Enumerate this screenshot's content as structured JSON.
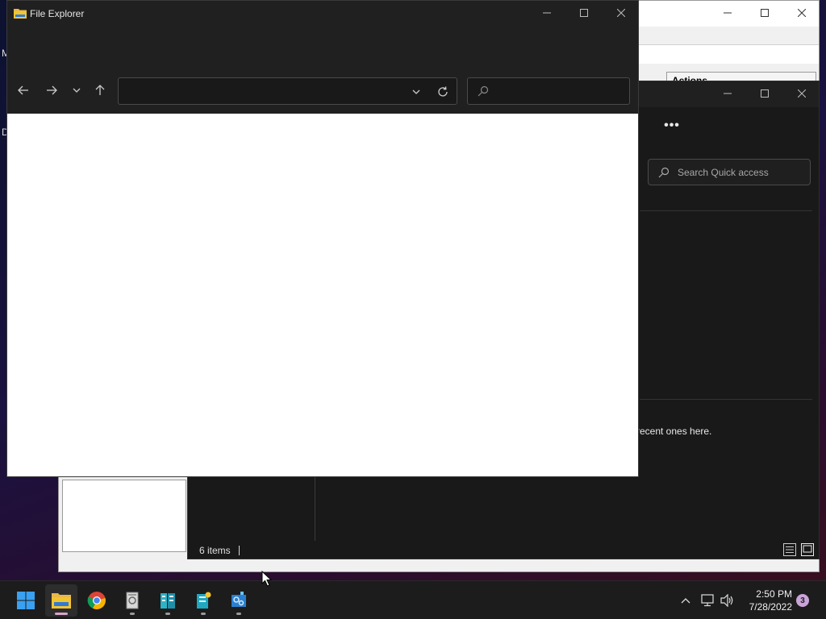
{
  "background_window": {
    "actions_header": "Actions",
    "clipped_letters": [
      "M",
      "D"
    ]
  },
  "quick_access_window": {
    "search_placeholder": "Search Quick access",
    "more_label": "•••",
    "empty_message": "recent ones here.",
    "status_items": "6 items"
  },
  "file_explorer": {
    "title": "File Explorer",
    "address_value": "",
    "search_value": ""
  },
  "taskbar": {
    "apps": [
      {
        "name": "start",
        "state": "none"
      },
      {
        "name": "file-explorer",
        "state": "focused"
      },
      {
        "name": "chrome",
        "state": "none"
      },
      {
        "name": "app-3",
        "state": "open"
      },
      {
        "name": "app-4",
        "state": "open"
      },
      {
        "name": "app-5",
        "state": "open"
      },
      {
        "name": "app-6",
        "state": "open"
      }
    ],
    "clock_time": "2:50 PM",
    "clock_date": "7/28/2022",
    "notification_count": "3"
  },
  "colors": {
    "accent": "#0078d4",
    "folder_yellow": "#f4c430",
    "badge": "#c9a4d8"
  }
}
